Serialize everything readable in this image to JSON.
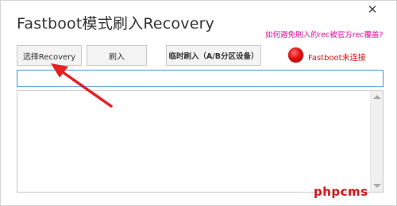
{
  "window": {
    "title": "Fastboot模式刷入Recovery",
    "close_glyph": "✕"
  },
  "help_link": {
    "label": "如何避免刷入的rec被官方rec覆盖?"
  },
  "toolbar": {
    "select_label": "选择Recovery",
    "flash_label": "刷入",
    "temp_flash_label": "临时刷入（A/B分区设备）"
  },
  "status": {
    "text": "Fastboot未连接",
    "color": "#e01010"
  },
  "path_input": {
    "value": ""
  },
  "log": {
    "value": ""
  },
  "watermark": "phpcms",
  "annotation_arrow_color": "#e52121"
}
